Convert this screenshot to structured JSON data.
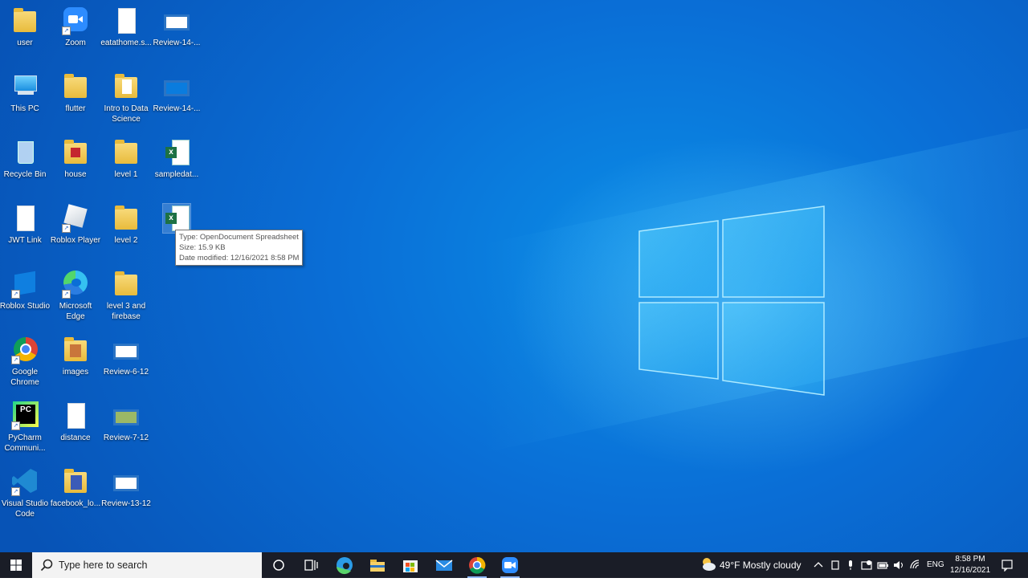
{
  "desktop": {
    "icons": [
      {
        "label": "user",
        "icon": "user-folder-icon"
      },
      {
        "label": "Zoom",
        "icon": "zoom-icon"
      },
      {
        "label": "eatathome.s...",
        "icon": "blank-file-icon"
      },
      {
        "label": "Review-14-...",
        "icon": "video-file-icon"
      },
      {
        "label": "This PC",
        "icon": "computer-icon"
      },
      {
        "label": "flutter",
        "icon": "folder-icon"
      },
      {
        "label": "Intro to Data Science",
        "icon": "folder-icon"
      },
      {
        "label": "Review-14-...",
        "icon": "video-file-icon"
      },
      {
        "label": "Recycle Bin",
        "icon": "recycle-bin-icon"
      },
      {
        "label": "house",
        "icon": "folder-icon"
      },
      {
        "label": "level 1",
        "icon": "folder-icon"
      },
      {
        "label": "sampledat...",
        "icon": "excel-file-icon"
      },
      {
        "label": "JWT Link",
        "icon": "blank-file-icon"
      },
      {
        "label": "Roblox Player",
        "icon": "roblox-icon"
      },
      {
        "label": "level 2",
        "icon": "folder-icon"
      },
      {
        "label": "t",
        "icon": "excel-file-icon"
      },
      {
        "label": "Roblox Studio",
        "icon": "roblox-studio-icon"
      },
      {
        "label": "Microsoft Edge",
        "icon": "edge-icon"
      },
      {
        "label": "level 3 and firebase",
        "icon": "folder-icon"
      },
      {
        "label": "Google Chrome",
        "icon": "chrome-icon"
      },
      {
        "label": "images",
        "icon": "folder-icon"
      },
      {
        "label": "Review-6-12",
        "icon": "video-file-icon"
      },
      {
        "label": "PyCharm Communi...",
        "icon": "pycharm-icon"
      },
      {
        "label": "distance",
        "icon": "blank-file-icon"
      },
      {
        "label": "Review-7-12",
        "icon": "video-file-icon"
      },
      {
        "label": "Visual Studio Code",
        "icon": "vscode-icon"
      },
      {
        "label": "facebook_lo...",
        "icon": "folder-icon"
      },
      {
        "label": "Review-13-12",
        "icon": "video-file-icon"
      }
    ],
    "tooltip": {
      "line1": "Type: OpenDocument Spreadsheet",
      "line2": "Size: 15.9 KB",
      "line3": "Date modified: 12/16/2021 8:58 PM"
    }
  },
  "taskbar": {
    "search_placeholder": "Type here to search",
    "apps": [
      "cortana-icon",
      "task-view-icon",
      "edge-icon",
      "file-explorer-icon",
      "store-icon",
      "mail-icon",
      "chrome-icon",
      "zoom-icon"
    ],
    "weather": "49°F  Mostly cloudy",
    "language": "ENG",
    "time": "8:58 PM",
    "date": "12/16/2021"
  },
  "colors": {
    "accent": "#0a78d7",
    "taskbar": "#1a1d27",
    "tooltip_border": "#767676"
  }
}
